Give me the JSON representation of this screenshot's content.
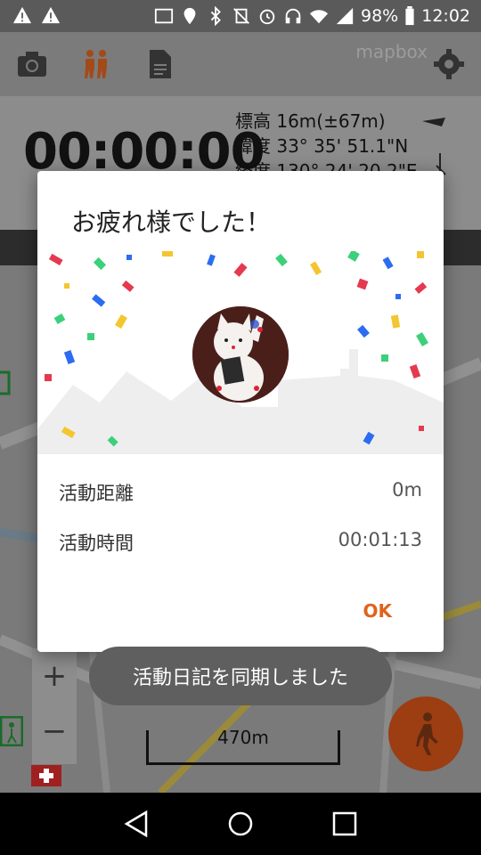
{
  "status_bar": {
    "battery": "98%",
    "time": "12:02"
  },
  "toolbar": {
    "mapbox_label": "mapbox",
    "icons": [
      "camera-icon",
      "hiking-party-icon",
      "document-icon",
      "gear-icon"
    ]
  },
  "info": {
    "elapsed": "00:00:00",
    "altitude": "標高 16m(±67m)",
    "latitude": "緯度 33° 35' 51.1\"N",
    "longitude": "経度 130° 24' 20.2\"E"
  },
  "dialog": {
    "title": "お疲れ様でした！",
    "distance_label": "活動距離",
    "distance_value": "0m",
    "time_label": "活動時間",
    "time_value": "00:01:13",
    "ok": "OK"
  },
  "toast": {
    "message": "活動日記を同期しました"
  },
  "map": {
    "zoom_in": "+",
    "zoom_out": "−",
    "scale_label": "470m"
  },
  "colors": {
    "accent": "#e0631c",
    "fab": "#9c3d12",
    "confetti": [
      "#e53950",
      "#2c6cf0",
      "#f3c62f",
      "#3bd07a",
      "#ff5e5e"
    ]
  }
}
